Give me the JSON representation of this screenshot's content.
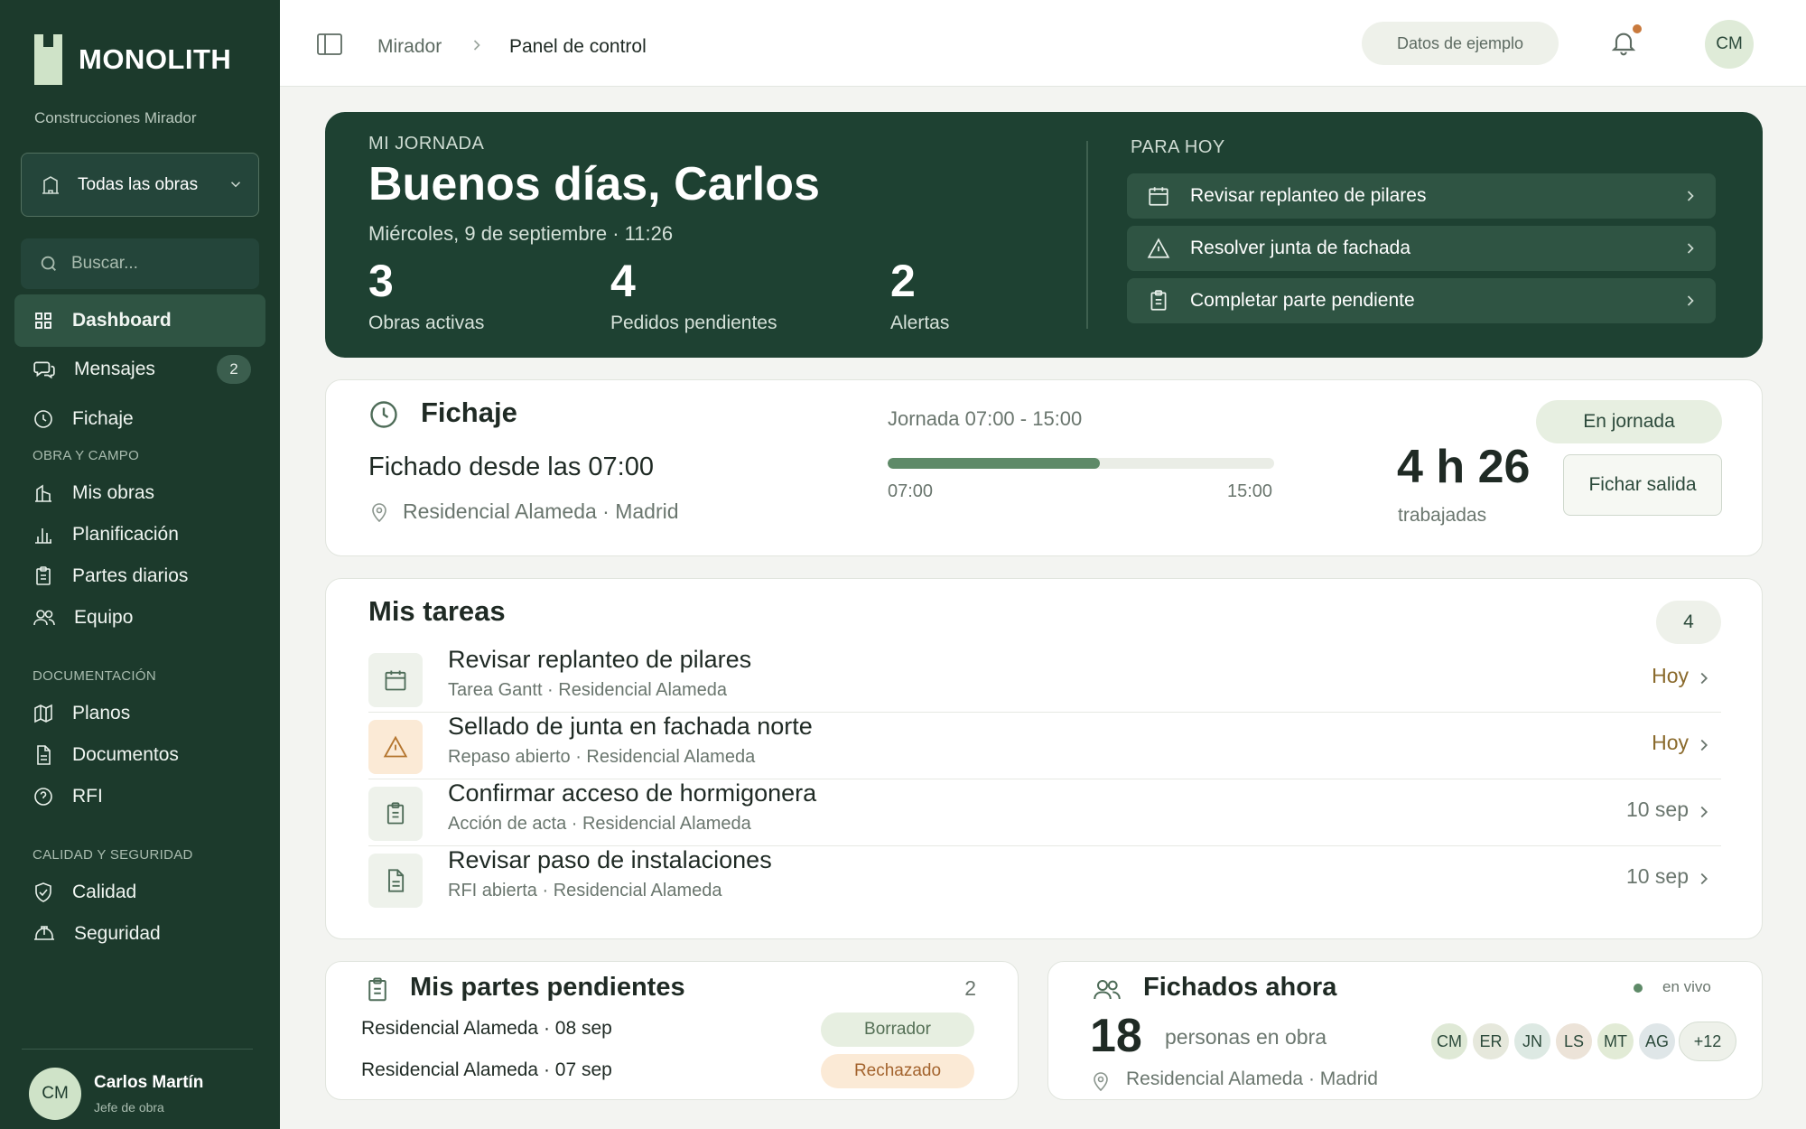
{
  "app": {
    "brand": "MONOLITH",
    "company": "Construcciones Mirador"
  },
  "sidebar": {
    "project_select": "Todas las obras",
    "search_placeholder": "Buscar...",
    "main_items": [
      {
        "label": "Dashboard",
        "icon": "grid-icon",
        "active": true
      },
      {
        "label": "Mensajes",
        "icon": "chat-icon",
        "badge": "2"
      },
      {
        "label": "Fichaje",
        "icon": "clock-icon"
      }
    ],
    "sections": [
      {
        "label": "OBRA Y CAMPO",
        "items": [
          {
            "label": "Mis obras",
            "icon": "building-icon"
          },
          {
            "label": "Planificación",
            "icon": "bar-chart-icon"
          },
          {
            "label": "Partes diarios",
            "icon": "clipboard-icon"
          },
          {
            "label": "Equipo",
            "icon": "users-icon"
          }
        ]
      },
      {
        "label": "DOCUMENTACIÓN",
        "items": [
          {
            "label": "Planos",
            "icon": "map-icon"
          },
          {
            "label": "Documentos",
            "icon": "document-icon"
          },
          {
            "label": "RFI",
            "icon": "help-circle-icon"
          }
        ]
      },
      {
        "label": "CALIDAD Y SEGURIDAD",
        "items": [
          {
            "label": "Calidad",
            "icon": "shield-check-icon"
          },
          {
            "label": "Seguridad",
            "icon": "hard-hat-icon"
          }
        ]
      }
    ],
    "user": {
      "initials": "CM",
      "name": "Carlos Martín",
      "role": "Jefe de obra"
    }
  },
  "topbar": {
    "breadcrumb": [
      "Mirador",
      "Panel de control"
    ],
    "sample_label": "Datos de ejemplo",
    "avatar_initials": "CM"
  },
  "hero": {
    "kicker": "MI JORNADA",
    "greeting": "Buenos días, Carlos",
    "date": "Miércoles, 9 de septiembre · 11:26",
    "stats": [
      {
        "value": "3",
        "label": "Obras activas"
      },
      {
        "value": "4",
        "label": "Pedidos pendientes"
      },
      {
        "value": "2",
        "label": "Alertas"
      }
    ],
    "today_label": "PARA HOY",
    "today_items": [
      {
        "label": "Revisar replanteo de pilares",
        "icon": "calendar-icon"
      },
      {
        "label": "Resolver junta de fachada",
        "icon": "warning-icon"
      },
      {
        "label": "Completar parte pendiente",
        "icon": "clipboard-icon"
      }
    ]
  },
  "fichaje": {
    "title": "Fichaje",
    "since": "Fichado desde las 07:00",
    "location": "Residencial Alameda · Madrid",
    "shift_label": "Jornada 07:00 - 15:00",
    "shift_start": "07:00",
    "shift_end": "15:00",
    "progress": 0.55,
    "worked": "4 h 26",
    "worked_label": "trabajadas",
    "status": "En jornada",
    "action": "Fichar salida"
  },
  "tasks": {
    "title": "Mis tareas",
    "count": "4",
    "items": [
      {
        "title": "Revisar replanteo de pilares",
        "sub": "Tarea Gantt · Residencial Alameda",
        "due": "Hoy",
        "icon": "calendar-icon",
        "today": true
      },
      {
        "title": "Sellado de junta en fachada norte",
        "sub": "Repaso abierto · Residencial Alameda",
        "due": "Hoy",
        "icon": "warning-icon",
        "today": true
      },
      {
        "title": "Confirmar acceso de hormigonera",
        "sub": "Acción de acta · Residencial Alameda",
        "due": "10 sep",
        "icon": "clipboard-icon",
        "today": false
      },
      {
        "title": "Revisar paso de instalaciones",
        "sub": "RFI abierta · Residencial Alameda",
        "due": "10 sep",
        "icon": "document-icon",
        "today": false
      }
    ]
  },
  "parts": {
    "title": "Mis partes pendientes",
    "count": "2",
    "items": [
      {
        "label": "Residencial Alameda · 08 sep",
        "status": "Borrador"
      },
      {
        "label": "Residencial Alameda · 07 sep",
        "status": "Rechazado"
      }
    ]
  },
  "now": {
    "title": "Fichados ahora",
    "live": "en vivo",
    "count": "18",
    "count_label": "personas en obra",
    "location": "Residencial Alameda · Madrid",
    "people": [
      {
        "initials": "CM",
        "color": "#dfe9d6"
      },
      {
        "initials": "ER",
        "color": "#e6e8dc"
      },
      {
        "initials": "JN",
        "color": "#dde9e3"
      },
      {
        "initials": "LS",
        "color": "#ece3d8"
      },
      {
        "initials": "MT",
        "color": "#e2ebd6"
      },
      {
        "initials": "AG",
        "color": "#dfe6e8"
      }
    ],
    "more": "+12"
  },
  "colors": {
    "sidebar": "#1c3a2c",
    "hero": "#1e4132",
    "accent": "#5e8a68",
    "warning": "#c97a3d"
  }
}
